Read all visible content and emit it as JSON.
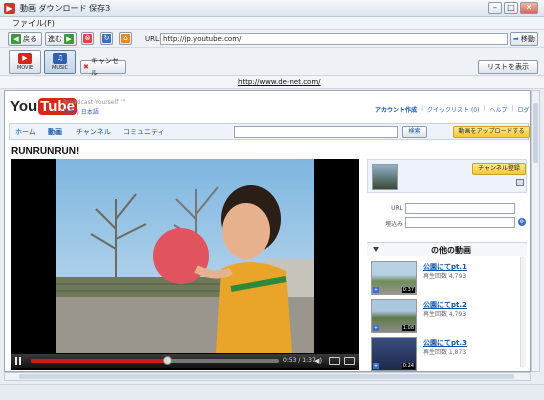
{
  "window": {
    "title": "動画 ダウンロード 保存3",
    "app_icon": "app-icon",
    "controls": {
      "minimize": "–",
      "maximize": "□",
      "close": "✕"
    }
  },
  "menu": {
    "file": "ファイル(F)"
  },
  "nav": {
    "back": "戻る",
    "forward": "進む",
    "url_label": "URL:",
    "url_value": "http://jp.youtube.com/",
    "go": "移動"
  },
  "toolbar2": {
    "movie": "MOVIE",
    "music": "MUSIC",
    "cancel": "キャンセル",
    "list": "リストを表示"
  },
  "site_link": "http://www.de-net.com/",
  "youtube": {
    "logo_you": "You",
    "logo_tube": "Tube",
    "tagline": "Broadcast Yourself ™",
    "region": "日本 | 日本語",
    "account": [
      "アカウント作成",
      "クイックリスト (0)",
      "ヘルプ",
      "ログイン"
    ],
    "tabs": [
      "ホーム",
      "動画",
      "チャンネル",
      "コミュニティ"
    ],
    "search_button": "検索",
    "upload_button": "動画をアップロードする",
    "video_title": "RUNRUNRUN!",
    "player": {
      "time": "0:53 / 1:37",
      "progress": 0.55
    },
    "subscribe": "チャンネル登録",
    "url_label": "URL",
    "embed_label": "埋込み",
    "more_videos": "の他の動画",
    "related": [
      {
        "title": "公園にてpt.1",
        "views": "再生回数 4,793",
        "duration": "0:37"
      },
      {
        "title": "公園にてpt.2",
        "views": "再生回数 4,793",
        "duration": "1:08"
      },
      {
        "title": "公園にてpt.3",
        "views": "再生回数 1,873",
        "duration": "0:24"
      }
    ]
  }
}
